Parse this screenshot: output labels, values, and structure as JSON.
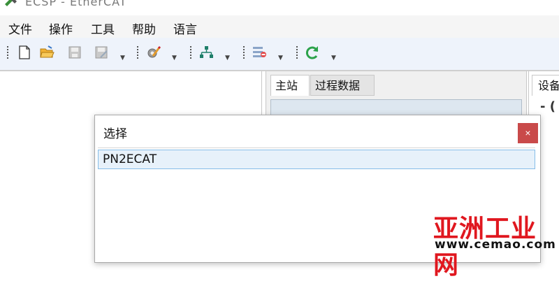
{
  "window": {
    "title": "ECSP - EtherCAT"
  },
  "menu": [
    "文件",
    "操作",
    "工具",
    "帮助",
    "语言"
  ],
  "toolbar": {
    "icons": [
      "new-file-icon",
      "open-folder-icon",
      "save-icon",
      "save-as-icon",
      "edit-settings-icon",
      "network-tree-icon",
      "list-remove-icon",
      "refresh-icon"
    ]
  },
  "tabs": {
    "master": "主站",
    "process_data": "过程数据",
    "device_partial": "设备"
  },
  "right_pane": {
    "mark": "- ("
  },
  "dialog": {
    "title": "选择",
    "close": "×",
    "items": [
      "PN2ECAT"
    ]
  },
  "watermark": {
    "brand": "亚洲工业网",
    "url": "www.cemao.com"
  },
  "colors": {
    "close_button": "#c94a4a",
    "selected_row": "#e7f1fa",
    "watermark_red": "#e0171f"
  }
}
